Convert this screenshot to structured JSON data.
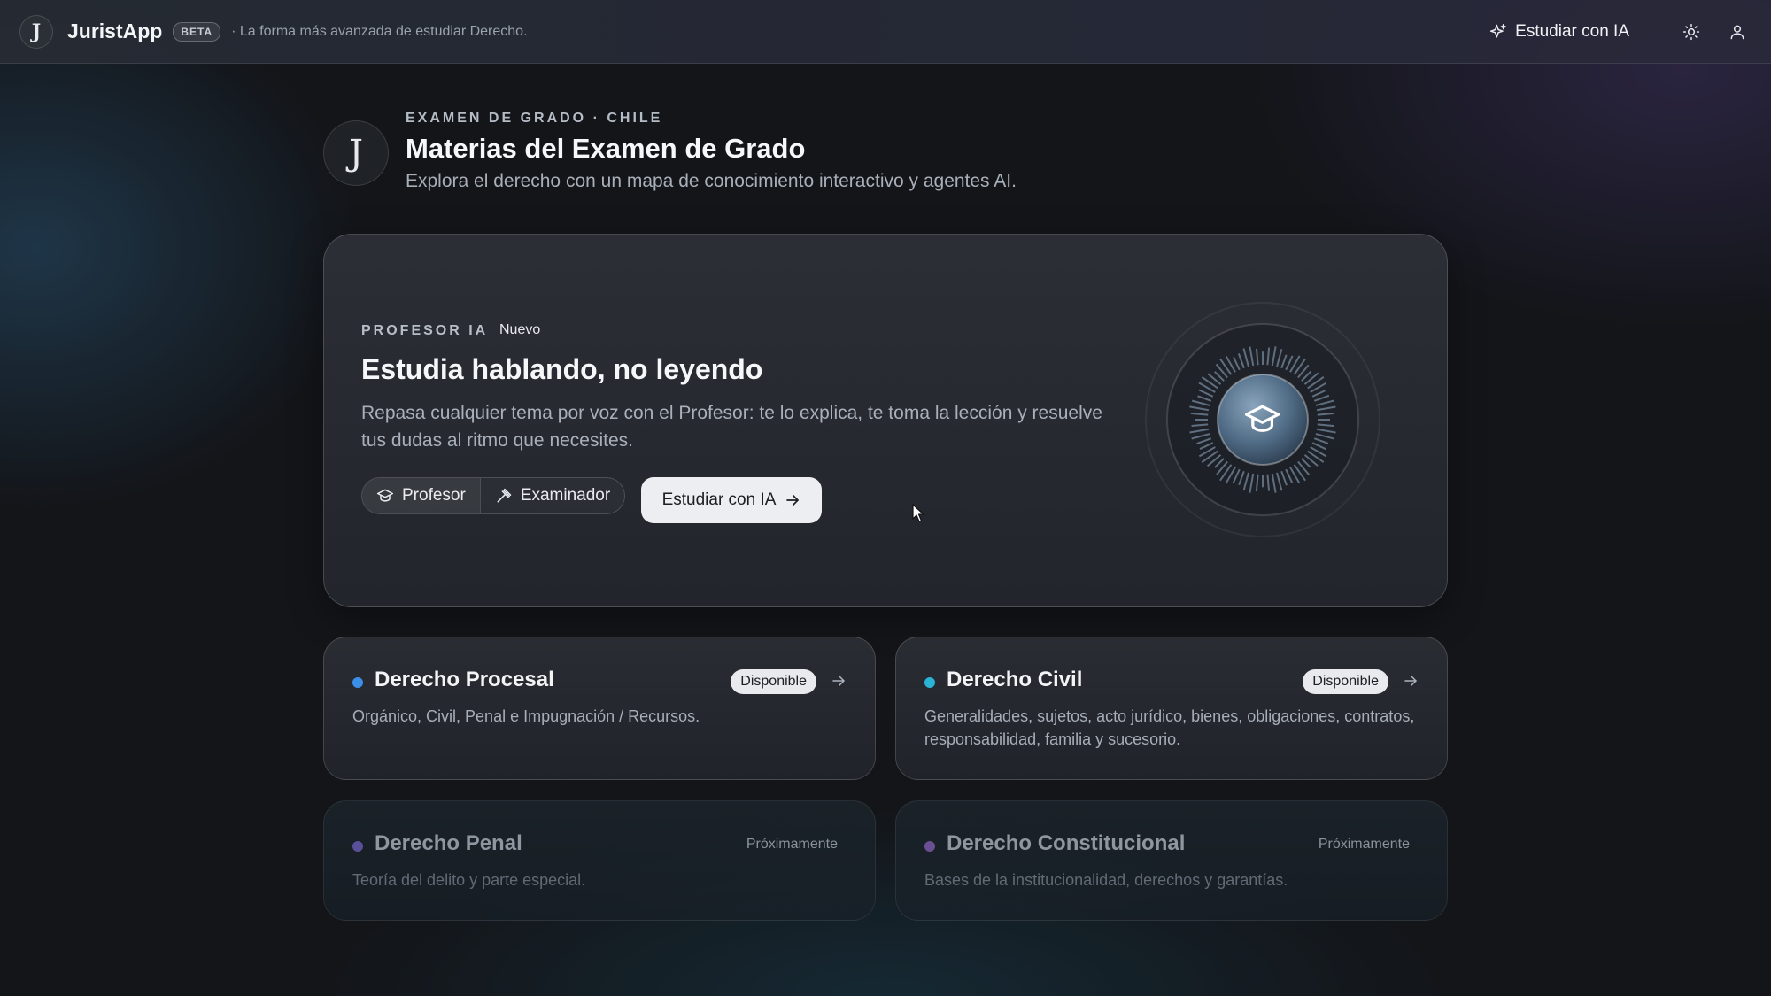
{
  "app": {
    "name": "JuristApp",
    "logo_letter": "J",
    "beta_label": "BETA",
    "tagline": "· La forma más avanzada de estudiar Derecho."
  },
  "topbar": {
    "cta_label": "Estudiar con IA",
    "icons": [
      "sparkles-icon",
      "sun-icon",
      "user-icon"
    ]
  },
  "page": {
    "logo_letter": "J",
    "eyebrow": "EXAMEN DE GRADO · CHILE",
    "title": "Materias del Examen de Grado",
    "subtitle": "Explora el derecho con un mapa de conocimiento interactivo y agentes AI."
  },
  "hero": {
    "eyebrow": "PROFESOR IA",
    "badge": "Nuevo",
    "title": "Estudia hablando, no leyendo",
    "description": "Repasa cualquier tema por voz con el Profesor: te lo explica, te toma la lección y resuelve tus dudas al ritmo que necesites.",
    "modes": [
      {
        "label": "Profesor",
        "icon": "graduation-cap-icon",
        "active": true
      },
      {
        "label": "Examinador",
        "icon": "gavel-icon",
        "active": false
      }
    ],
    "cta_label": "Estudiar con IA",
    "orb_icon": "graduation-cap-icon"
  },
  "subjects": [
    {
      "name": "Derecho Procesal",
      "description": "Orgánico, Civil, Penal e Impugnación / Recursos.",
      "status": "Disponible",
      "dot_color": "#3b8fe6"
    },
    {
      "name": "Derecho Civil",
      "description": "Generalidades, sujetos, acto jurídico, bienes, obligaciones, contratos, responsabilidad, familia y sucesorio.",
      "status": "Disponible",
      "dot_color": "#2bb3d6"
    },
    {
      "name": "Derecho Penal",
      "description": "Teoría del delito y parte especial.",
      "status": "Próximamente",
      "dot_color": "#5a4f9a"
    },
    {
      "name": "Derecho Constitucional",
      "description": "Bases de la institucionalidad, derechos y garantías.",
      "status": "Próximamente",
      "dot_color": "#6a4f92"
    }
  ]
}
